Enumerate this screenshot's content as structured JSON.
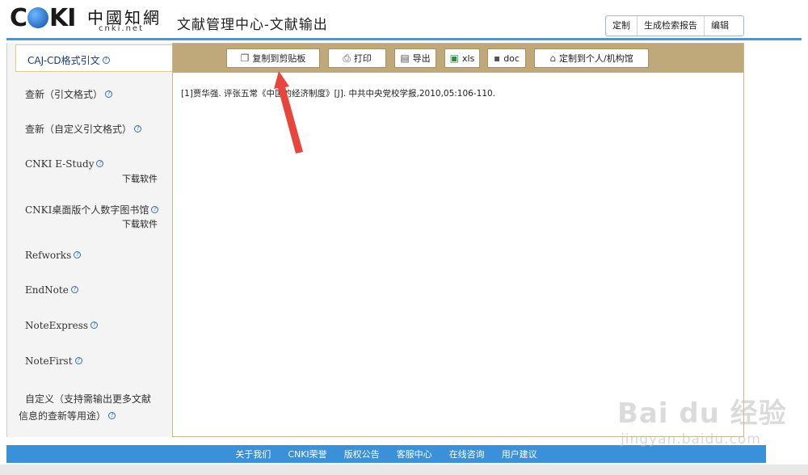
{
  "header": {
    "logo_brand": "CNKI",
    "logo_cn": "中國知網",
    "logo_url": "cnki.net",
    "title": "文献管理中心-文献输出",
    "actions": [
      "定制",
      "生成检索报告",
      "编辑"
    ]
  },
  "sidebar": {
    "items": [
      {
        "label": "CAJ-CD格式引文",
        "help": "?",
        "download": ""
      },
      {
        "label": "查新（引文格式）",
        "help": "?",
        "download": ""
      },
      {
        "label": "查新（自定义引文格式）",
        "help": "?",
        "download": ""
      },
      {
        "label": "CNKI E-Study",
        "help": "?",
        "download": "下载软件"
      },
      {
        "label": "CNKI桌面版个人数字图书馆",
        "help": "?",
        "download": "下载软件"
      },
      {
        "label": "Refworks",
        "help": "?",
        "download": ""
      },
      {
        "label": "EndNote",
        "help": "?",
        "download": ""
      },
      {
        "label": "NoteExpress",
        "help": "?",
        "download": ""
      },
      {
        "label": "NoteFirst",
        "help": "?",
        "download": ""
      },
      {
        "label": "自定义（支持需输出更多文献",
        "label2": "信息的查新等用途）",
        "help": "?",
        "download": ""
      }
    ]
  },
  "toolbar": {
    "copy": "复制到剪贴板",
    "print": "打印",
    "export": "导出",
    "xls": "xls",
    "doc": "doc",
    "custom": "定制到个人/机构馆"
  },
  "citation": "[1]贾华强. 评张五常《中国的经济制度》[J]. 中共中央党校学报,2010,05:106-110.",
  "footer": {
    "links": [
      "关于我们",
      "CNKI荣誉",
      "版权公告",
      "客服中心",
      "在线咨询",
      "用户建议"
    ]
  },
  "watermark": {
    "text": "Bai du 经验",
    "url": "jingyan.baidu.com"
  },
  "colors": {
    "accent_blue": "#3a90d9",
    "toolbar_tan": "#bfa87a",
    "annotation_red": "#e8453c"
  }
}
